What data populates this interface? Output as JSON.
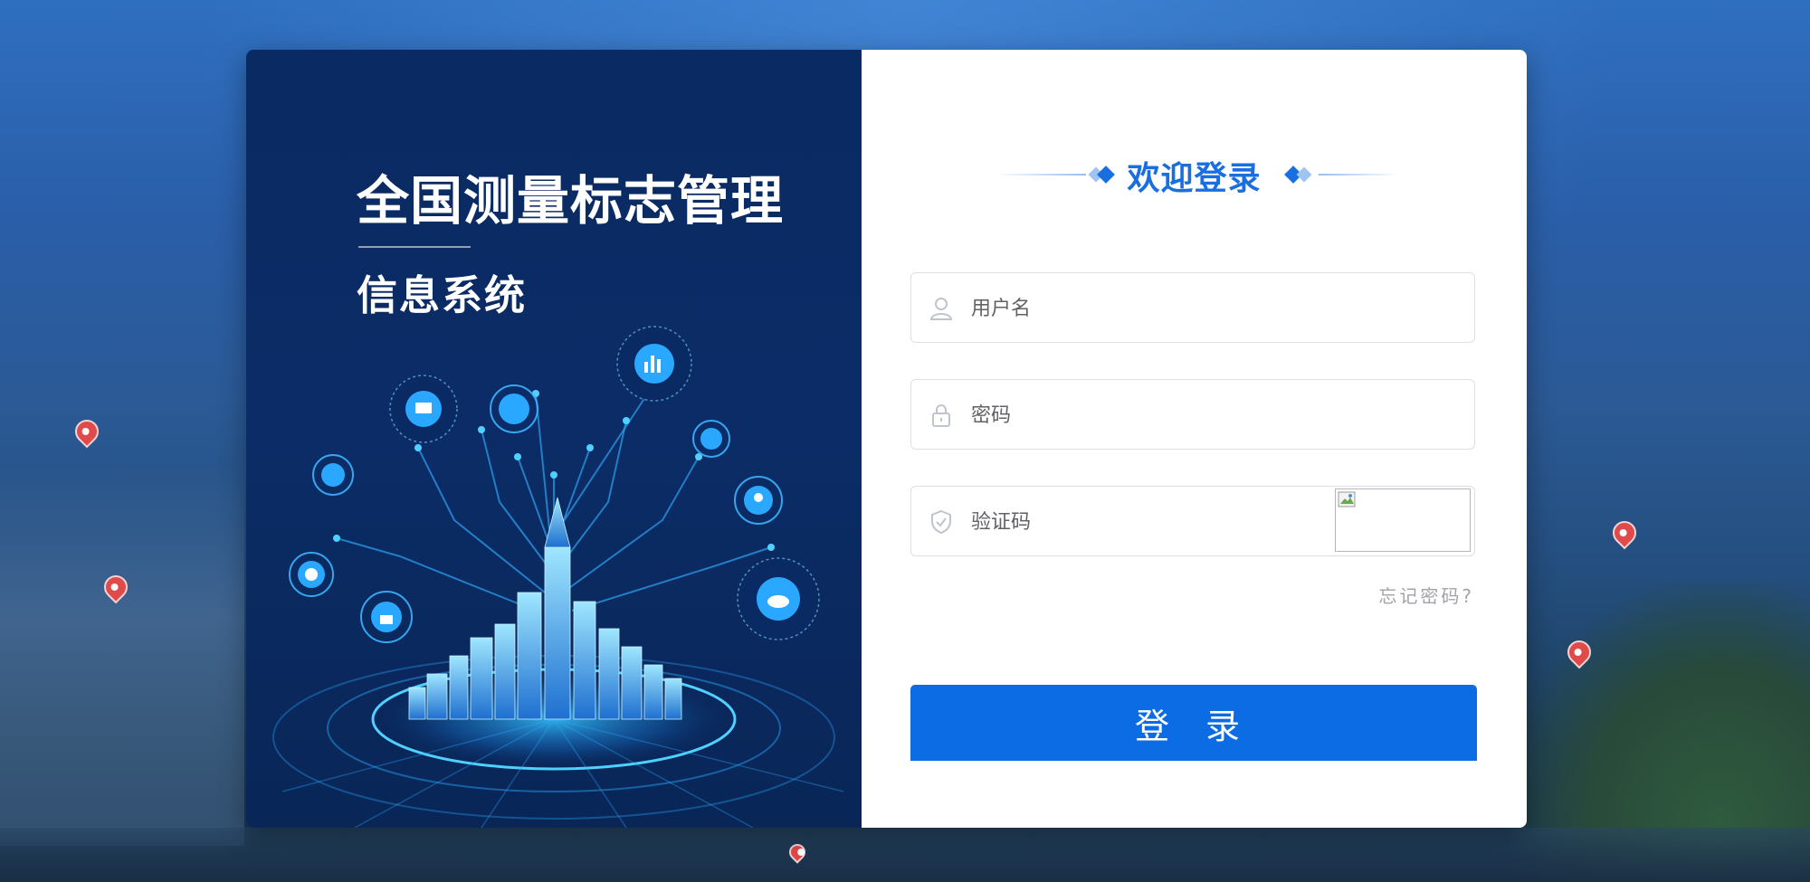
{
  "app": {
    "title_main": "全国测量标志管理",
    "title_sub": "信息系统"
  },
  "login": {
    "welcome": "欢迎登录",
    "username_placeholder": "用户名",
    "password_placeholder": "密码",
    "captcha_placeholder": "验证码",
    "forgot_password": "忘记密码?",
    "submit_label": "登 录"
  },
  "icons": {
    "username": "user-icon",
    "password": "lock-icon",
    "captcha": "shield-check-icon",
    "captcha_image": "broken-image-icon"
  },
  "colors": {
    "accent": "#0c6ce3",
    "left_panel": "#0a2a63",
    "welcome_text": "#1a6fe0"
  }
}
